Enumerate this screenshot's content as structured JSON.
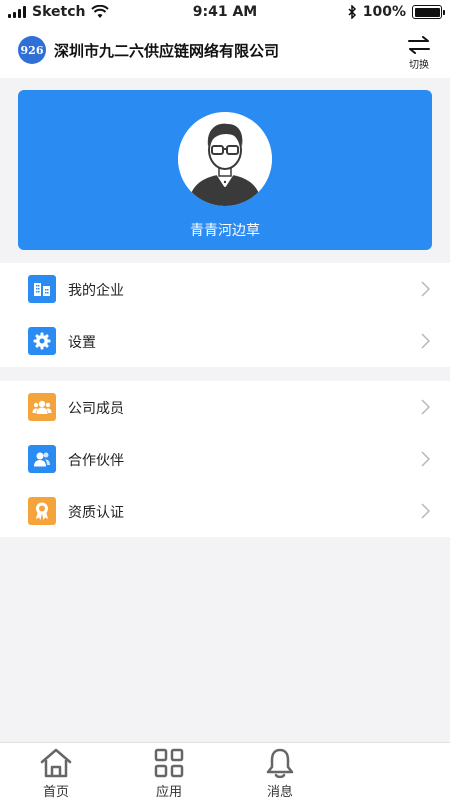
{
  "status_bar": {
    "carrier": "Sketch",
    "time": "9:41 AM",
    "battery_percent": "100%",
    "battery_level": 1.0,
    "icons": [
      "signal-icon",
      "wifi-icon",
      "bluetooth-icon",
      "battery-icon"
    ]
  },
  "header": {
    "logo_text": "926",
    "company_name": "深圳市九二六供应链网络有限公司",
    "switch_label": "切换",
    "switch_icon": "switch-arrows-icon"
  },
  "profile": {
    "username": "青青河边草",
    "avatar_icon": "avatar-icon",
    "card_color": "#2a8bf2"
  },
  "menu_groups": [
    {
      "items": [
        {
          "label": "我的企业",
          "icon": "building-icon",
          "icon_color": "#2a8bf2"
        },
        {
          "label": "设置",
          "icon": "gear-icon",
          "icon_color": "#2a8bf2"
        }
      ]
    },
    {
      "items": [
        {
          "label": "公司成员",
          "icon": "members-icon",
          "icon_color": "#f5a43c"
        },
        {
          "label": "合作伙伴",
          "icon": "partner-icon",
          "icon_color": "#2a8bf2"
        },
        {
          "label": "资质认证",
          "icon": "certificate-icon",
          "icon_color": "#f5a43c"
        }
      ]
    }
  ],
  "tabbar": {
    "tabs": [
      {
        "label": "首页",
        "icon": "home-icon"
      },
      {
        "label": "应用",
        "icon": "grid-icon"
      },
      {
        "label": "消息",
        "icon": "bell-icon"
      }
    ]
  }
}
